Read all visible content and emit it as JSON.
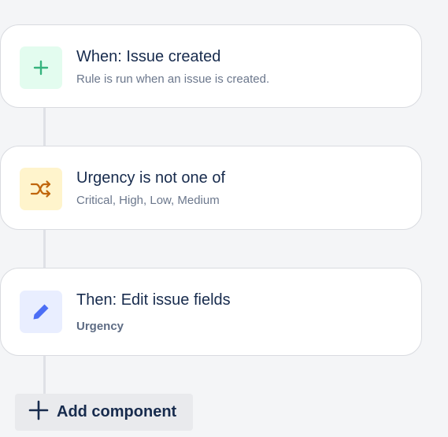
{
  "steps": [
    {
      "id": "trigger",
      "icon": "plus-icon",
      "color": "#36b37e",
      "title": "When: Issue created",
      "subtitle": "Rule is run when an issue is created."
    },
    {
      "id": "condition",
      "icon": "shuffle-icon",
      "color": "#c0660d",
      "title": "Urgency is not one of",
      "subtitle": "Critical, High, Low, Medium"
    },
    {
      "id": "action",
      "icon": "pencil-icon",
      "color": "#4c6ef5",
      "title": "Then: Edit issue fields",
      "subtitle": "Urgency"
    }
  ],
  "add_component": {
    "label": "Add component",
    "icon": "plus-icon"
  }
}
